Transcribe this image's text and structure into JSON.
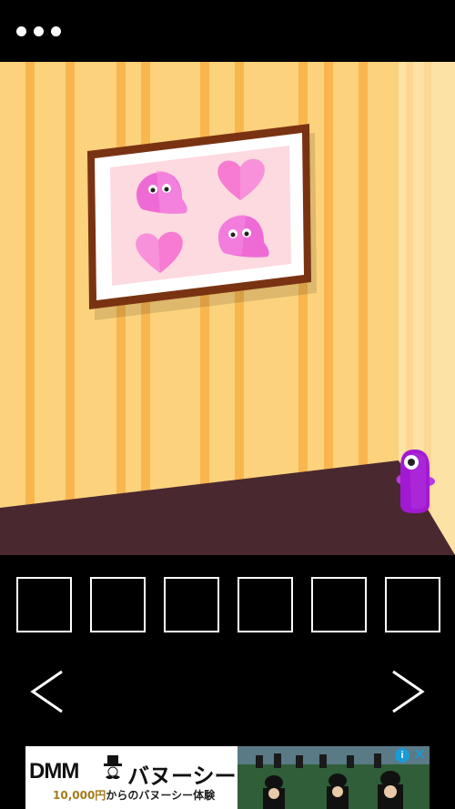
{
  "header": {
    "menu_icon": "more-dots-icon"
  },
  "scene": {
    "wall_color": "#fcd27d",
    "stripe_color": "#f9b349",
    "floor_color": "#4a2830",
    "frame_color": "#7a3312",
    "picture_bg": "#fdd9e0",
    "ghost_color": "#ee6bd6",
    "heart_color": "#f77bd0",
    "creature_color": "#a11ad1"
  },
  "inventory": {
    "slot_count": 6
  },
  "navigation": {
    "left_icon": "chevron-left-icon",
    "right_icon": "chevron-right-icon"
  },
  "ad": {
    "brand": "DMM",
    "brand2": "バヌーシー",
    "sub_price": "10,000円",
    "sub_text": "からのバヌーシー体験",
    "info_label": "i",
    "close_label": "✕"
  }
}
